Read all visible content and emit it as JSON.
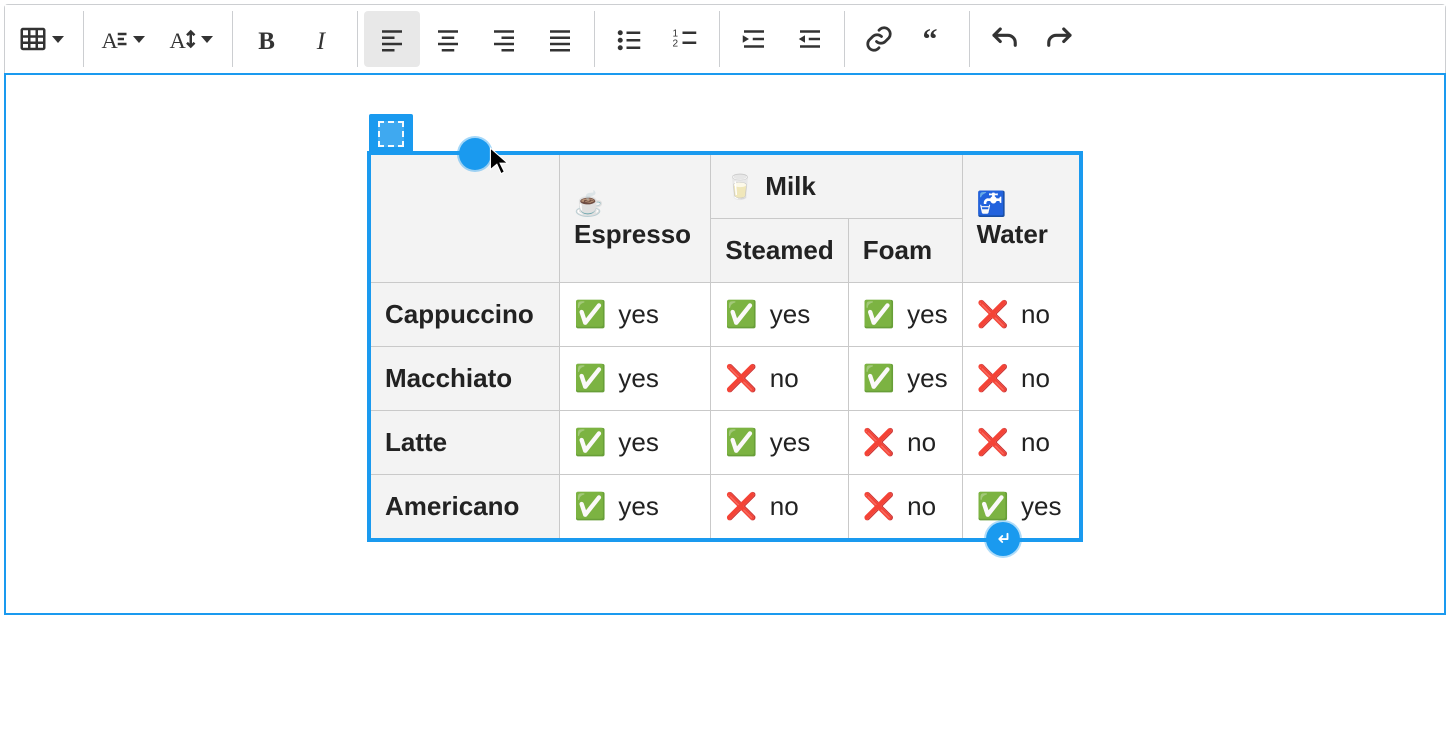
{
  "toolbar": {
    "table": "Insert table",
    "heading": "Heading",
    "fontsize": "Font size",
    "bold": "Bold",
    "italic": "Italic",
    "alignLeft": "Align left",
    "alignCenter": "Align center",
    "alignRight": "Align right",
    "alignJustify": "Justify",
    "bulleted": "Bulleted list",
    "numbered": "Numbered list",
    "indent": "Increase indent",
    "outdent": "Decrease indent",
    "link": "Link",
    "blockquote": "Block quote",
    "undo": "Undo",
    "redo": "Redo"
  },
  "table": {
    "corner": "",
    "headers": {
      "espresso_icon": "☕",
      "espresso": "Espresso",
      "milk_icon": "🥛",
      "milk": "Milk",
      "steamed": "Steamed",
      "foam": "Foam",
      "water_icon": "🚰",
      "water": "Water"
    },
    "rowLabels": [
      "Cappuccino",
      "Macchiato",
      "Latte",
      "Americano"
    ],
    "cells": [
      [
        "yes",
        "yes",
        "yes",
        "no"
      ],
      [
        "yes",
        "no",
        "yes",
        "no"
      ],
      [
        "yes",
        "yes",
        "no",
        "no"
      ],
      [
        "yes",
        "no",
        "no",
        "yes"
      ]
    ],
    "yesIcon": "✅",
    "noIcon": "❌",
    "yesText": "yes",
    "noText": "no"
  }
}
